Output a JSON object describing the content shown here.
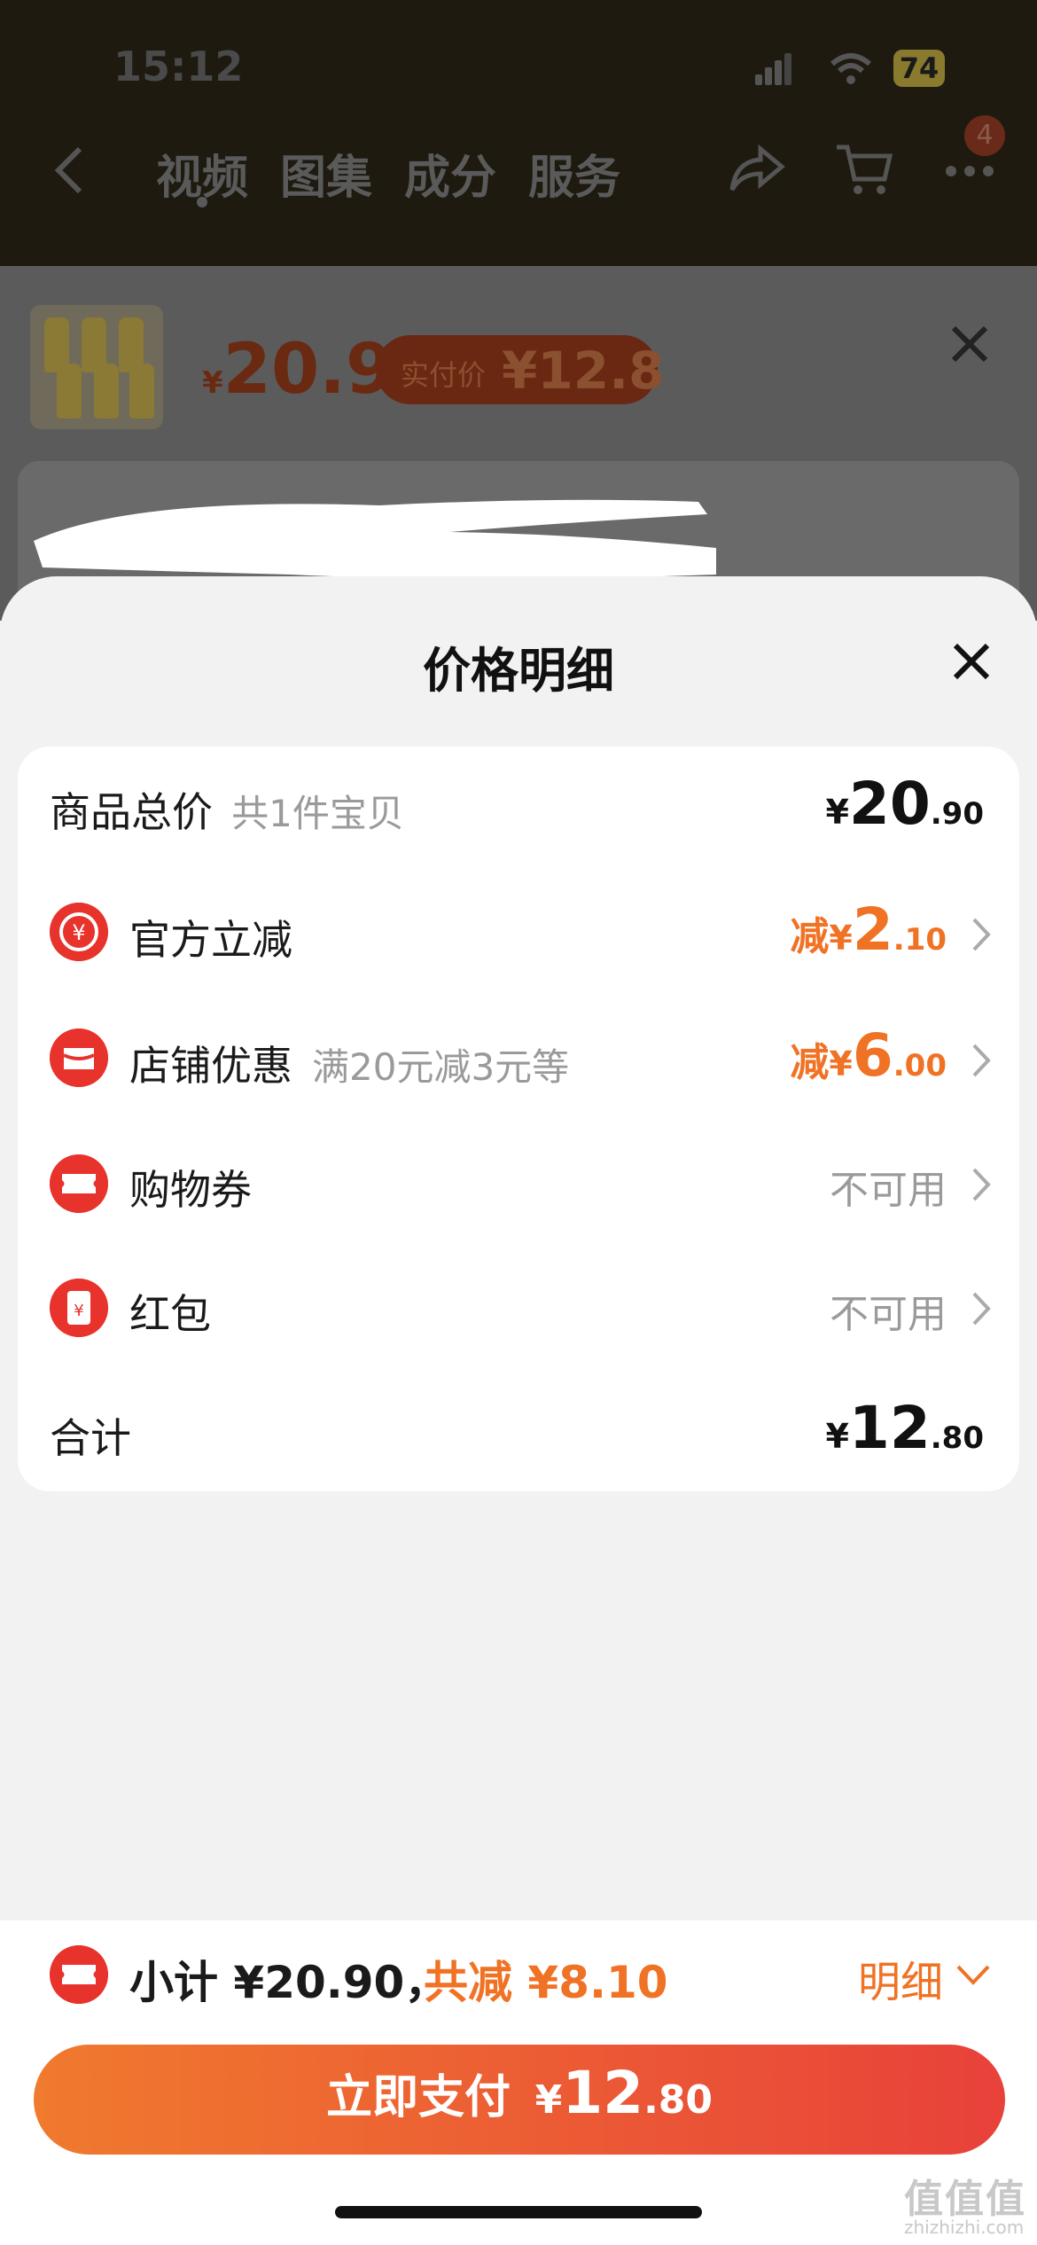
{
  "status_bar": {
    "time": "15:12",
    "battery": "74"
  },
  "nav": {
    "tabs": [
      "视频",
      "图集",
      "成分",
      "服务"
    ],
    "cart_badge": "4"
  },
  "product": {
    "price_currency": "¥",
    "price": "20.9",
    "real_price_label": "实付价",
    "real_price": "¥12.8"
  },
  "modal": {
    "title": "价格明细",
    "rows": [
      {
        "label": "商品总价",
        "sub": "共1件宝贝",
        "currency": "¥",
        "amount_int": "20",
        "amount_dec": ".90"
      },
      {
        "label": "官方立减",
        "prefix": "减",
        "currency": "¥",
        "amount_int": "2",
        "amount_dec": ".10"
      },
      {
        "label": "店铺优惠",
        "sub": "满20元减3元等",
        "prefix": "减",
        "currency": "¥",
        "amount_int": "6",
        "amount_dec": ".00"
      },
      {
        "label": "购物券",
        "status": "不可用"
      },
      {
        "label": "红包",
        "status": "不可用"
      },
      {
        "label": "合计",
        "currency": "¥",
        "amount_int": "12",
        "amount_dec": ".80"
      }
    ]
  },
  "bottom": {
    "subtotal": "小计 ¥20.90，",
    "reduced": "共减 ¥8.10",
    "detail_label": "明细",
    "pay_label": "立即支付",
    "pay_currency": "¥",
    "pay_int": "12",
    "pay_dec": ".80"
  },
  "watermark": {
    "brand": "值值值",
    "domain": "zhizhizhi.com"
  },
  "colors": {
    "accent": "#f07224",
    "red": "#e8322c",
    "button_from": "#f07a2e",
    "button_to": "#e8413a"
  }
}
